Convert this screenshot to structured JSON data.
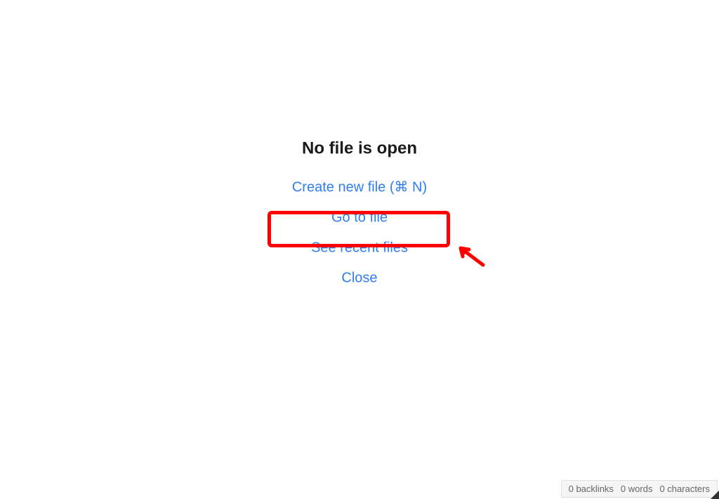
{
  "empty_state": {
    "title": "No file is open",
    "actions": {
      "create_new": "Create new file (⌘ N)",
      "go_to_file": "Go to file",
      "see_recent": "See recent files",
      "close": "Close"
    }
  },
  "status_bar": {
    "backlinks": "0 backlinks",
    "words": "0 words",
    "characters": "0 characters"
  },
  "annotation": {
    "highlighted_action": "create_new",
    "highlight_color": "#ff0000"
  }
}
